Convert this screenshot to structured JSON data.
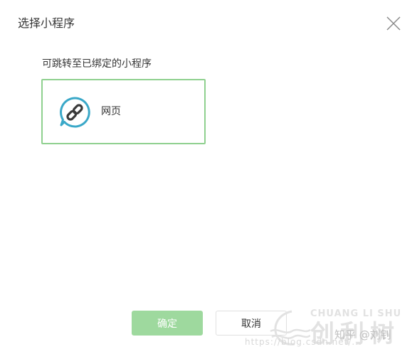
{
  "dialog": {
    "title": "选择小程序",
    "close_icon": "close-icon"
  },
  "content": {
    "section_label": "可跳转至已绑定的小程序",
    "mini_programs": [
      {
        "name": "网页",
        "icon": "link-chat-icon",
        "selected": true
      }
    ]
  },
  "footer": {
    "confirm_label": "确定",
    "cancel_label": "取消"
  },
  "watermark": {
    "brand_en": "CHUANG LI SHU",
    "brand_cn": "创利树",
    "overlay": "知乎 @刘钊",
    "url": "https://blog.csdn.net/..."
  },
  "colors": {
    "selected_border": "#8fd08f",
    "confirm_bg": "#9ed99e",
    "icon_ring": "#3aa8c8"
  }
}
